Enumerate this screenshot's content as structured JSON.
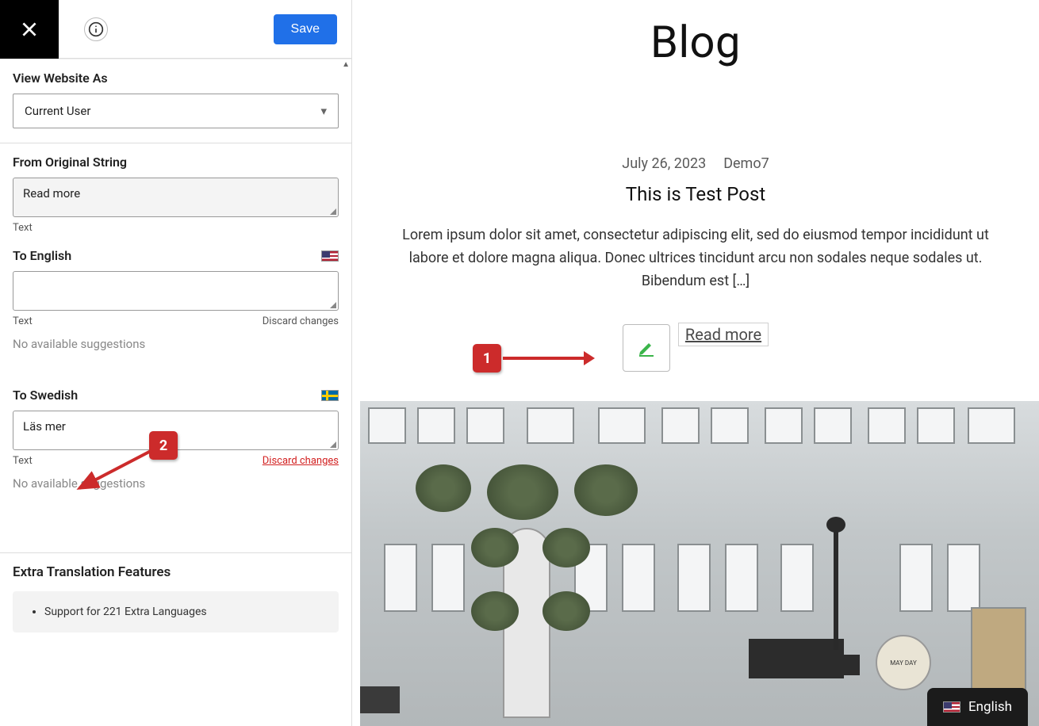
{
  "topbar": {
    "save_label": "Save"
  },
  "section_view": {
    "heading": "View Website As",
    "selected": "Current User"
  },
  "section_from": {
    "heading": "From Original String",
    "value": "Read more",
    "type_label": "Text"
  },
  "section_en": {
    "heading": "To English",
    "value": "",
    "type_label": "Text",
    "discard": "Discard changes",
    "suggestions": "No available suggestions"
  },
  "section_sv": {
    "heading": "To Swedish",
    "value": "Läs mer",
    "type_label": "Text",
    "discard": "Discard changes",
    "suggestions": "No available suggestions"
  },
  "extra": {
    "heading": "Extra Translation Features",
    "item1": "Support for 221 Extra Languages"
  },
  "preview": {
    "blog_title": "Blog",
    "post_date": "July 26, 2023",
    "post_author": "Demo7",
    "post_title": "This is Test Post",
    "post_body": "Lorem ipsum dolor sit amet, consectetur adipiscing elit, sed do eiusmod tempor incididunt ut labore et dolore magna aliqua. Donec ultrices tincidunt arcu non sodales neque sodales ut. Bibendum est […]",
    "read_more": "Read more",
    "switcher_label": "English"
  },
  "callouts": {
    "c1": "1",
    "c2": "2"
  }
}
